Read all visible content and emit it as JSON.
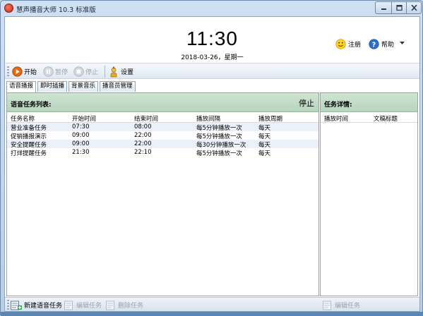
{
  "window": {
    "title": "慧声播音大师 10.3 标准版",
    "controls": {
      "minimize": "minimize",
      "maximize": "maximize",
      "close": "close"
    }
  },
  "header": {
    "clock": "11:30",
    "date": "2018-03-26，星期一",
    "register_label": "注册",
    "help_label": "帮助"
  },
  "toolbar": {
    "start_label": "开始",
    "pause_label": "暂停",
    "stop_label": "停止",
    "settings_label": "设置"
  },
  "tabs": [
    {
      "label": "语音播报",
      "active": true
    },
    {
      "label": "即时插播",
      "active": false
    },
    {
      "label": "背景音乐",
      "active": false
    },
    {
      "label": "播音员管理",
      "active": false
    }
  ],
  "task_panel": {
    "title": "语音任务列表:",
    "state": "停止",
    "columns": [
      "任务名称",
      "开始时间",
      "结束时间",
      "播放间隔",
      "播放周期"
    ],
    "rows": [
      [
        "营业准备任务",
        "07:30",
        "08:00",
        "每5分钟播放一次",
        "每天"
      ],
      [
        "促销播报演示",
        "09:00",
        "22:00",
        "每5分钟播放一次",
        "每天"
      ],
      [
        "安全提醒任务",
        "09:00",
        "22:00",
        "每30分钟播放一次",
        "每天"
      ],
      [
        "打烊提醒任务",
        "21:30",
        "22:10",
        "每5分钟播放一次",
        "每天"
      ]
    ]
  },
  "detail_panel": {
    "title": "任务详情:",
    "columns": [
      "播放时间",
      "文稿标题"
    ]
  },
  "bottom": {
    "new_task_label": "新建语音任务",
    "edit_task_label": "编辑任务",
    "delete_task_label": "删除任务",
    "edit_task_right_label": "编辑任务"
  }
}
